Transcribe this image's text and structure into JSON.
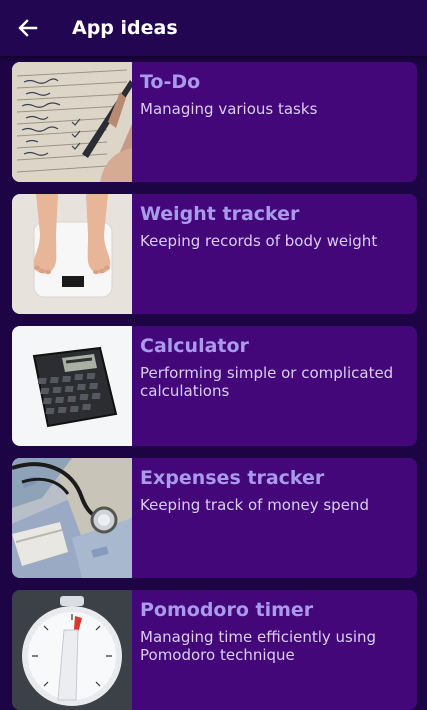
{
  "appbar": {
    "title": "App ideas",
    "back_icon": "arrow-left-icon"
  },
  "colors": {
    "background": "#1d0545",
    "appbar": "#220652",
    "card": "#43077a",
    "card_title": "#a99aeb",
    "card_subtitle": "#d8cfee"
  },
  "ideas": [
    {
      "title": "To-Do",
      "subtitle": "Managing various tasks",
      "image": "notebook-writing-image"
    },
    {
      "title": "Weight tracker",
      "subtitle": "Keeping records of body weight",
      "image": "bathroom-scale-image"
    },
    {
      "title": "Calculator",
      "subtitle": "Performing simple or complicated calculations",
      "image": "calculator-image"
    },
    {
      "title": "Expenses tracker",
      "subtitle": "Keeping track of money spend",
      "image": "money-stethoscope-image"
    },
    {
      "title": "Pomodoro timer",
      "subtitle": "Managing time efficiently using Pomodoro technique",
      "image": "kitchen-timer-image"
    }
  ]
}
